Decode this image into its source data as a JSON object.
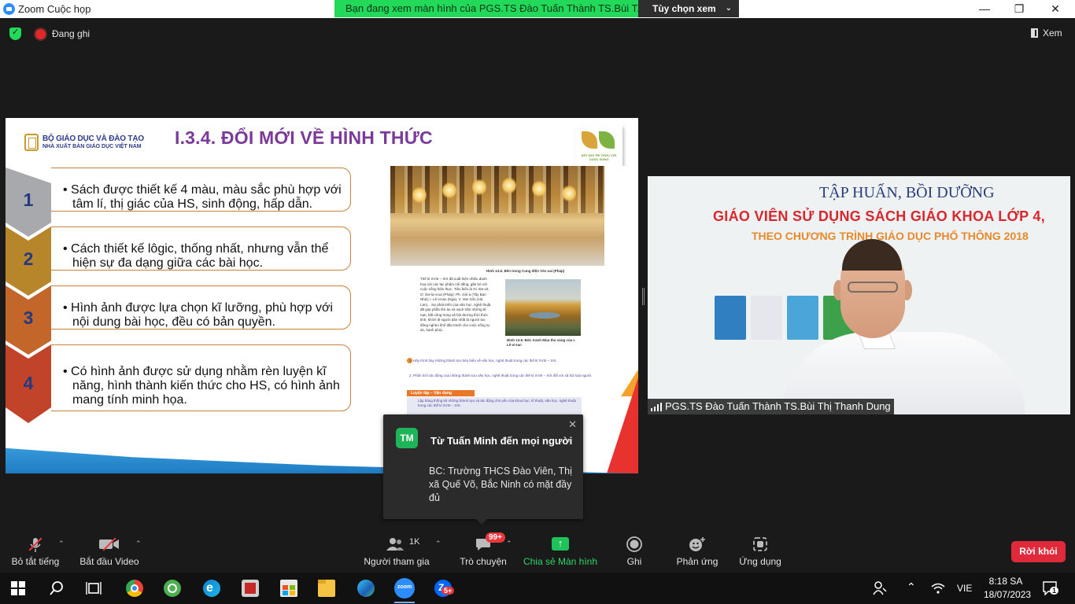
{
  "window": {
    "title": "Zoom Cuộc họp",
    "viewing_banner": "Bạn đang xem màn hình của PGS.TS Đào Tuấn Thành TS.Bùi T...",
    "view_options": "Tùy chọn xem",
    "minimize": "—",
    "maximize": "❐",
    "close": "✕"
  },
  "topbar": {
    "recording": "Đang ghi",
    "view": "Xem"
  },
  "slide": {
    "ministry": "BỘ GIÁO DỤC VÀ ĐÀO TẠO",
    "publisher": "NHÀ XUẤT BẢN GIÁO DỤC VIỆT NAM",
    "title": "I.3.4. ĐỔI MỚI VỀ HÌNH THỨC",
    "logo_caption": "KẾT NỐI TRI THỨC VỚI CUỘC SỐNG",
    "items": [
      {
        "number": "1",
        "text": "Sách được thiết kế 4 màu, màu sắc phù hợp với tâm lí, thị giác của HS, sinh động, hấp dẫn.",
        "color": "#a7a9ac"
      },
      {
        "number": "2",
        "text": "Cách thiết kế lôgic, thống nhất, nhưng vẫn thể hiện sự đa dạng giữa các bài học.",
        "color": "#b8862a"
      },
      {
        "number": "3",
        "text": "Hình ảnh được lựa chọn kĩ lưỡng, phù hợp với nội dung bài học, đều có bản quyền.",
        "color": "#c2662a"
      },
      {
        "number": "4",
        "text": "Có hình ảnh được sử dụng nhằm rèn luyện kĩ năng, hình thành kiến thức cho HS, có hình ảnh mang tính minh họa.",
        "color": "#c0432a"
      }
    ],
    "book": {
      "fig1_caption": "Hình 13.5. Bên trong Cung điện Véc-xai (Pháp)",
      "paragraph": "Thế kỉ XVIII – XIX đã xuất hiện nhiều danh hoạ với các tác phẩm nổi tiếng, gắn bó với cuộc sống hiện thực. Tiêu biểu là Gi. Đa-vít, Ơ. Đơ-la-croa (Pháp); Ph. Gôi-a (Tây Ban Nha); I. Lê-vi-tan (Nga), V. Van Gốc (Hà Lan)... Sự phát triển của văn học, nghệ thuật đã góp phần lên án và vạch trần những tệ nạn, bất công trong xã hội đương thời thức tỉnh, khích lệ người dân nhất là người lao động nghèo khổ đấu tranh cho cuộc sống tự do, hạnh phúc.",
      "fig2_caption": "Hình 13.6. Bức tranh Mùa thu vàng của I. Lê-vi-tan",
      "q1": "1. Hãy trình bày những thành tựu tiêu biểu về văn học, nghệ thuật trong các thế kỉ XVIII – XIX.",
      "q2": "2. Phân tích tác động của những thành tựu văn học, nghệ thuật trong các thế kỉ XVIII – XIX đối với xã hội loài người.",
      "practice_tag": "Luyện tập – Vận dụng",
      "practice_text": "Lập bảng thống kê những thành tựu và tác động chủ yếu của khoa học, kĩ thuật, văn học, nghệ thuật trong các thế kỉ XVIII – XIX."
    }
  },
  "video": {
    "banner1": "TẬP HUẤN, BỒI DƯỠNG",
    "banner2": "GIÁO VIÊN SỬ DỤNG SÁCH GIÁO KHOA LỚP 4,",
    "banner3": "THEO CHƯƠNG TRÌNH GIÁO DỤC PHỔ THÔNG 2018",
    "participant_name": "PGS.TS Đào Tuấn Thành TS.Bùi Thị Thanh Dung"
  },
  "chat_popup": {
    "avatar": "TM",
    "from": "Từ Tuấn Minh đến mọi người",
    "message": "BC: Trường THCS Đào Viên, Thị xã Quế Võ, Bắc Ninh có mặt đầy đủ",
    "close": "✕"
  },
  "toolbar": {
    "mute": "Bỏ tắt tiếng",
    "video": "Bắt đầu Video",
    "participants": "Người tham gia",
    "participants_count": "1K",
    "chat": "Trò chuyện",
    "chat_badge": "99+",
    "share": "Chia sẻ Màn hình",
    "record": "Ghi",
    "reactions": "Phản ứng",
    "apps": "Ứng dụng",
    "leave": "Rời khỏi"
  },
  "taskbar": {
    "language": "VIE",
    "time": "8:18 SA",
    "date": "18/07/2023",
    "notifications": "1",
    "zalo_badge": "5+"
  }
}
